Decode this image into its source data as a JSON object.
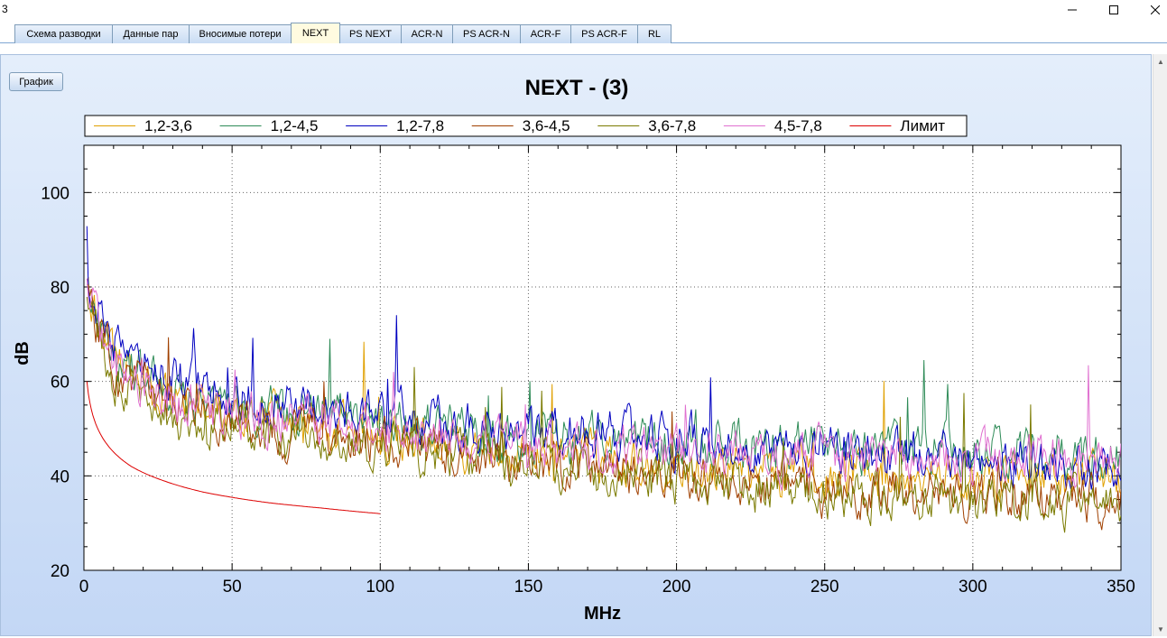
{
  "window": {
    "title": "3"
  },
  "tabs": [
    {
      "label": "Схема разводки",
      "active": false
    },
    {
      "label": "Данные пар",
      "active": false
    },
    {
      "label": "Вносимые потери",
      "active": false
    },
    {
      "label": "NEXT",
      "active": true
    },
    {
      "label": "PS NEXT",
      "active": false
    },
    {
      "label": "ACR-N",
      "active": false
    },
    {
      "label": "PS ACR-N",
      "active": false
    },
    {
      "label": "ACR-F",
      "active": false
    },
    {
      "label": "PS ACR-F",
      "active": false
    },
    {
      "label": "RL",
      "active": false
    }
  ],
  "toolbar": {
    "graph_button": "График"
  },
  "chart_data": {
    "type": "line",
    "title": "NEXT - (3)",
    "xlabel": "MHz",
    "ylabel": "dB",
    "xlim": [
      0,
      350
    ],
    "ylim": [
      20,
      110
    ],
    "xticks": [
      0,
      50,
      100,
      150,
      200,
      250,
      300,
      350
    ],
    "yticks": [
      20,
      40,
      60,
      80,
      100
    ],
    "grid": true,
    "legend": "top",
    "series": [
      {
        "name": "1,2-3,6",
        "color": "#e0a000",
        "baseline": [
          [
            1,
            78
          ],
          [
            10,
            63
          ],
          [
            30,
            56
          ],
          [
            60,
            52
          ],
          [
            100,
            49
          ],
          [
            150,
            45
          ],
          [
            200,
            42
          ],
          [
            250,
            40
          ],
          [
            300,
            40
          ],
          [
            350,
            41
          ]
        ],
        "amplitude": 9,
        "seed": 11
      },
      {
        "name": "1,2-4,5",
        "color": "#2e8b57",
        "baseline": [
          [
            1,
            80
          ],
          [
            10,
            66
          ],
          [
            30,
            58
          ],
          [
            60,
            54
          ],
          [
            100,
            51
          ],
          [
            150,
            48
          ],
          [
            200,
            47
          ],
          [
            250,
            46
          ],
          [
            300,
            45
          ],
          [
            350,
            45
          ]
        ],
        "amplitude": 9,
        "seed": 23
      },
      {
        "name": "1,2-7,8",
        "color": "#0000c0",
        "baseline": [
          [
            1,
            82
          ],
          [
            10,
            68
          ],
          [
            30,
            60
          ],
          [
            60,
            56
          ],
          [
            100,
            53
          ],
          [
            150,
            50
          ],
          [
            200,
            48
          ],
          [
            250,
            46
          ],
          [
            300,
            44
          ],
          [
            350,
            42
          ]
        ],
        "amplitude": 9,
        "seed": 37
      },
      {
        "name": "3,6-4,5",
        "color": "#a04000",
        "baseline": [
          [
            1,
            78
          ],
          [
            10,
            63
          ],
          [
            30,
            55
          ],
          [
            60,
            51
          ],
          [
            100,
            47
          ],
          [
            150,
            43
          ],
          [
            200,
            40
          ],
          [
            250,
            37
          ],
          [
            300,
            36
          ],
          [
            350,
            35
          ]
        ],
        "amplitude": 9,
        "seed": 41
      },
      {
        "name": "3,6-7,8",
        "color": "#7a7a00",
        "baseline": [
          [
            1,
            77
          ],
          [
            10,
            61
          ],
          [
            30,
            53
          ],
          [
            60,
            49
          ],
          [
            100,
            46
          ],
          [
            150,
            42
          ],
          [
            200,
            39
          ],
          [
            250,
            36
          ],
          [
            300,
            35
          ],
          [
            350,
            34
          ]
        ],
        "amplitude": 9,
        "seed": 53
      },
      {
        "name": "4,5-7,8",
        "color": "#e070d0",
        "baseline": [
          [
            1,
            79
          ],
          [
            10,
            64
          ],
          [
            30,
            56
          ],
          [
            60,
            52
          ],
          [
            100,
            49
          ],
          [
            150,
            47
          ],
          [
            200,
            45
          ],
          [
            250,
            44
          ],
          [
            300,
            44
          ],
          [
            350,
            44
          ]
        ],
        "amplitude": 9,
        "seed": 67
      },
      {
        "name": "Лимит",
        "color": "#dd0000",
        "points": [
          [
            1,
            60
          ],
          [
            2,
            55.5
          ],
          [
            4,
            51
          ],
          [
            8,
            46.5
          ],
          [
            16,
            42
          ],
          [
            25,
            39.4
          ],
          [
            40,
            36.6
          ],
          [
            62.5,
            34.3
          ],
          [
            80,
            33.2
          ],
          [
            100,
            32
          ]
        ]
      }
    ]
  }
}
